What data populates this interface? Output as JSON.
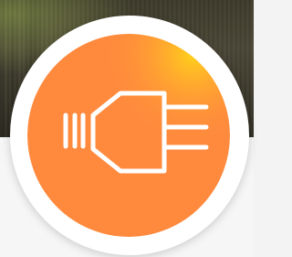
{
  "badge": {
    "icon": "plug-icon",
    "colors": {
      "primary": "#ff8a3d",
      "highlight": "#ffd21a",
      "ring": "#ffffff",
      "icon_stroke": "#ffffff"
    }
  }
}
